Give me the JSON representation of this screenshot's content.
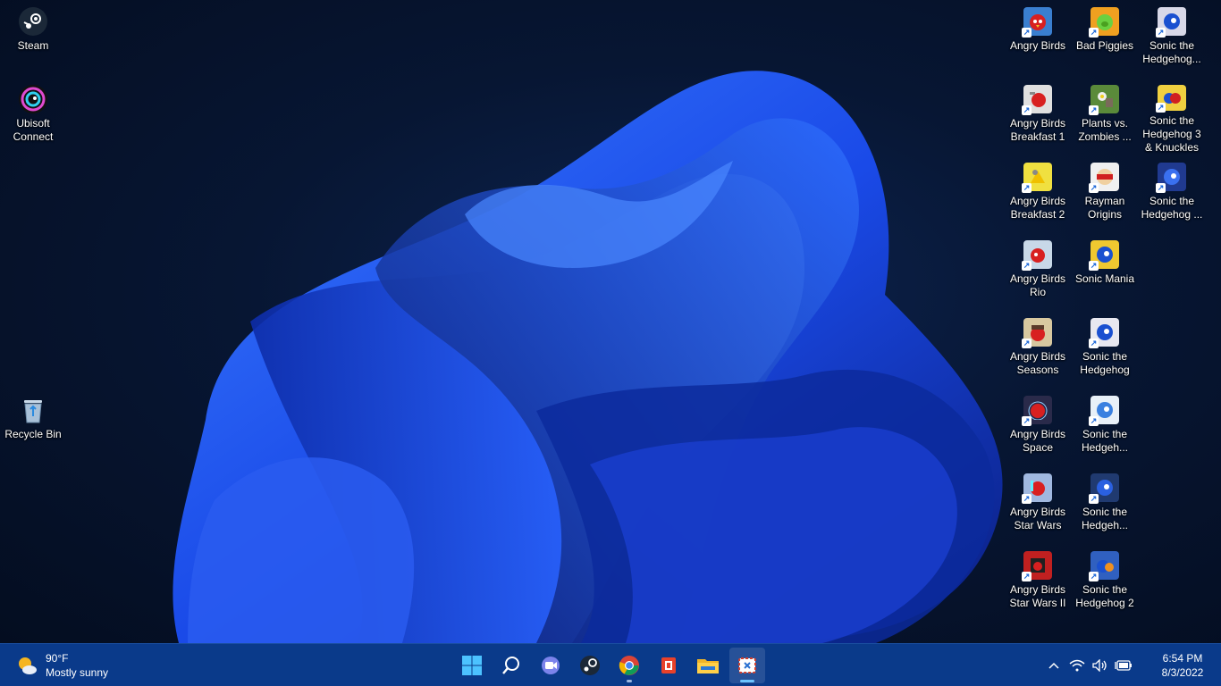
{
  "desktop": {
    "icons_left": [
      {
        "label": "Steam",
        "icon": "steam-icon",
        "color": "#1b2838"
      },
      {
        "label": "Ubisoft Connect",
        "icon": "ubisoft-icon",
        "color": "#222222"
      },
      {
        "label": "Recycle Bin",
        "icon": "recycle-bin-icon",
        "color": "#8aa8c8"
      }
    ],
    "icons_right": [
      {
        "label": "Angry Birds",
        "icon": "angry-birds-icon",
        "color": "#3a7fd0"
      },
      {
        "label": "Bad Piggies",
        "icon": "bad-piggies-icon",
        "color": "#f0a020"
      },
      {
        "label": "Sonic the Hedgehog...",
        "icon": "sonic-icon",
        "color": "#d8d8e8"
      },
      {
        "label": "Angry Birds Breakfast 1",
        "icon": "angry-birds-breakfast-icon",
        "color": "#e0e0e0"
      },
      {
        "label": "Plants vs. Zombies ...",
        "icon": "plants-vs-zombies-icon",
        "color": "#5a8a3a"
      },
      {
        "label": "Sonic the Hedgehog 3 & Knuckles",
        "icon": "sonic-3-icon",
        "color": "#f0d040"
      },
      {
        "label": "Angry Birds Breakfast 2",
        "icon": "angry-birds-breakfast-icon",
        "color": "#f0e040"
      },
      {
        "label": "Rayman Origins",
        "icon": "rayman-icon",
        "color": "#f0f0f0"
      },
      {
        "label": "Sonic the Hedgehog ...",
        "icon": "sonic-icon",
        "color": "#203a90"
      },
      {
        "label": "Angry Birds Rio",
        "icon": "angry-birds-rio-icon",
        "color": "#c8d8e8"
      },
      {
        "label": "Sonic Mania",
        "icon": "sonic-mania-icon",
        "color": "#f0c830"
      },
      {
        "label": "Angry Birds Seasons",
        "icon": "angry-birds-seasons-icon",
        "color": "#d8c8a0"
      },
      {
        "label": "Sonic the Hedgehog",
        "icon": "sonic-icon",
        "color": "#e8e8f0"
      },
      {
        "label": "Angry Birds Space",
        "icon": "angry-birds-space-icon",
        "color": "#2a2a4a"
      },
      {
        "label": "Sonic the Hedgeh...",
        "icon": "sonic-icon",
        "color": "#e8f0f8"
      },
      {
        "label": "Angry Birds Star Wars",
        "icon": "angry-birds-star-wars-icon",
        "color": "#a0b8e0"
      },
      {
        "label": "Sonic the Hedgeh...",
        "icon": "sonic-icon",
        "color": "#203a70"
      },
      {
        "label": "Angry Birds Star Wars II",
        "icon": "angry-birds-star-wars-2-icon",
        "color": "#c02020"
      },
      {
        "label": "Sonic the Hedgehog 2",
        "icon": "sonic-2-icon",
        "color": "#3060c0"
      }
    ]
  },
  "taskbar": {
    "weather": {
      "temp": "90°F",
      "condition": "Mostly sunny"
    },
    "apps": [
      {
        "name": "start-button",
        "icon": "windows-logo-icon"
      },
      {
        "name": "search-button",
        "icon": "search-icon"
      },
      {
        "name": "chat-button",
        "icon": "teams-chat-icon"
      },
      {
        "name": "steam-taskbar-button",
        "icon": "steam-icon"
      },
      {
        "name": "chrome-taskbar-button",
        "icon": "chrome-icon"
      },
      {
        "name": "office-taskbar-button",
        "icon": "office-icon"
      },
      {
        "name": "file-explorer-button",
        "icon": "folder-icon"
      },
      {
        "name": "snipping-tool-button",
        "icon": "snipping-tool-icon"
      }
    ],
    "clock": {
      "time": "6:54 PM",
      "date": "8/3/2022"
    }
  },
  "colors": {
    "taskbar": "#0a3a8a",
    "accent": "#1a66d8",
    "wallpaper_bloom": "#1e4ef0"
  }
}
